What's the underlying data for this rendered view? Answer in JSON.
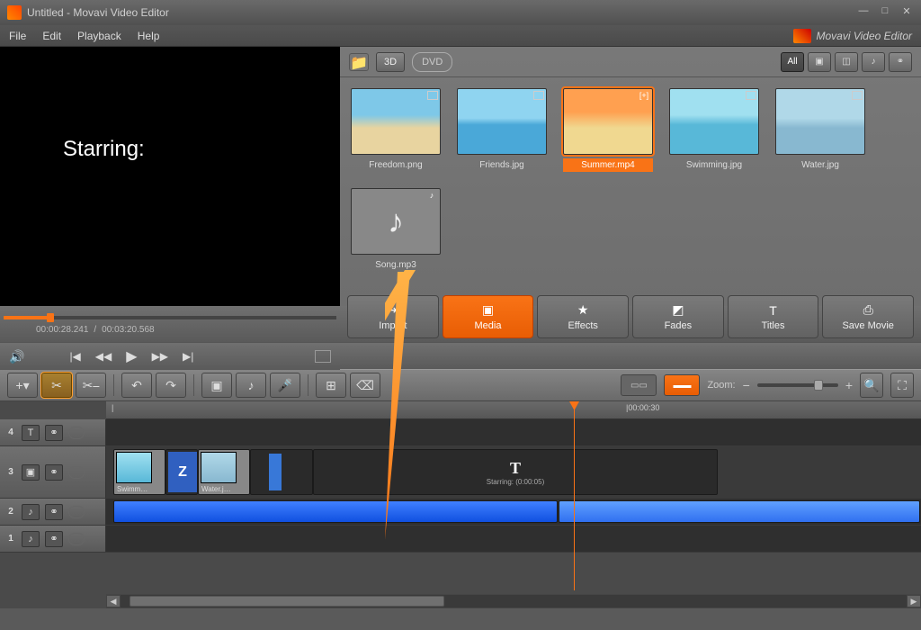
{
  "window": {
    "title": "Untitled - Movavi Video Editor",
    "brand": "Movavi Video Editor"
  },
  "menu": {
    "file": "File",
    "edit": "Edit",
    "playback": "Playback",
    "help": "Help"
  },
  "mediaToolbar": {
    "threeD": "3D",
    "dvd": "DVD",
    "viewAll": "All"
  },
  "media": {
    "items": [
      {
        "label": "Freedom.png"
      },
      {
        "label": "Friends.jpg"
      },
      {
        "label": "Summer.mp4"
      },
      {
        "label": "Swimming.jpg"
      },
      {
        "label": "Water.jpg"
      },
      {
        "label": "Song.mp3"
      }
    ]
  },
  "preview": {
    "text": "Starring:",
    "currentTime": "00:00:28.241",
    "totalTime": "00:03:20.568"
  },
  "tabs": {
    "import": "Import",
    "media": "Media",
    "effects": "Effects",
    "fades": "Fades",
    "titles": "Titles",
    "save": "Save Movie"
  },
  "timeline": {
    "zoomLabel": "Zoom:",
    "ruler": {
      "t1": "|00:00:30",
      "t0": ""
    },
    "titleClip": {
      "letter": "T",
      "caption": "Starring: (0:00:05)"
    },
    "clips": {
      "c1": "Swimm…",
      "c2": "Water.j…",
      "z": "Z"
    }
  }
}
